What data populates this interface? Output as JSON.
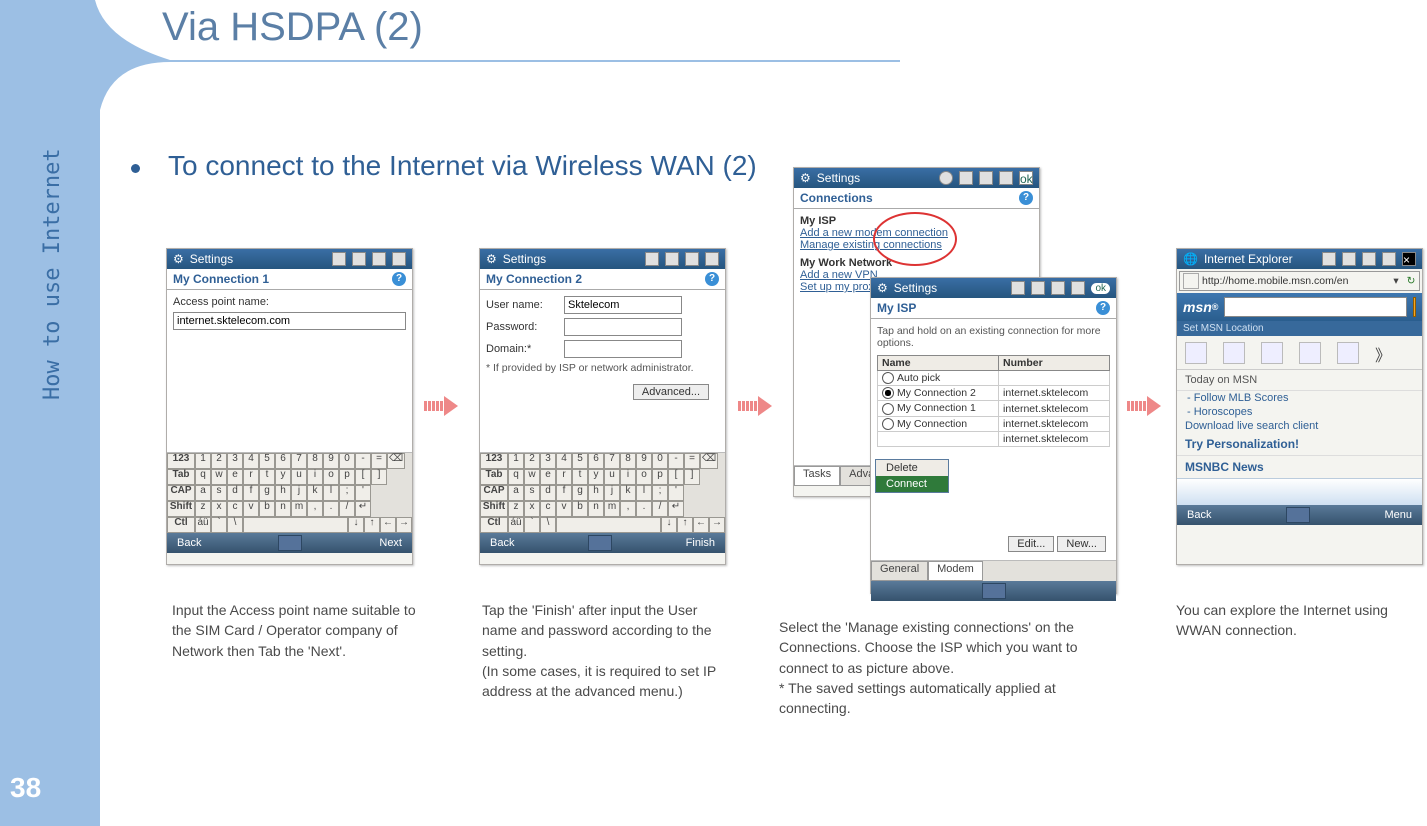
{
  "page_number": "38",
  "side_label": "How to use Internet",
  "title": "Via HSDPA (2)",
  "bullet": "To connect to the Internet via Wireless WAN (2)",
  "steps": {
    "s1": {
      "win_title": "Settings",
      "subbar": "My Connection 1",
      "label_apn": "Access point name:",
      "apn_value": "internet.sktelecom.com",
      "soft_left": "Back",
      "soft_right": "Next",
      "caption": "Input the Access point name suitable to the SIM Card / Operator company of Network then Tab the  'Next'."
    },
    "s2": {
      "win_title": "Settings",
      "subbar": "My Connection 2",
      "label_user": "User name:",
      "user_value": "Sktelecom",
      "label_pass": "Password:",
      "label_domain": "Domain:*",
      "note": "* If provided by ISP or network administrator.",
      "btn_advanced": "Advanced...",
      "soft_left": "Back",
      "soft_right": "Finish",
      "caption": "Tap the 'Finish' after input the User name and password according to the setting.\n(In some cases, it is required to set IP address at the advanced menu.)"
    },
    "s3": {
      "back_win_title": "Settings",
      "back_subbar": "Connections",
      "my_isp": "My ISP",
      "link_add": "Add a new modem connection",
      "link_manage": "Manage existing connections",
      "my_work": "My Work Network",
      "link_add_vpn": "Add a new VPN",
      "link_setup": "Set up my proxy",
      "tasks_tab": "Tasks",
      "advanced_tab": "Advanced",
      "front_win_title": "Settings",
      "front_ok": "ok",
      "front_subbar": "My ISP",
      "front_note": "Tap and hold on an existing connection for more options.",
      "col_name": "Name",
      "col_number": "Number",
      "rows": [
        {
          "name": "Auto pick",
          "number": ""
        },
        {
          "name": "My Connection 2",
          "number": "internet.sktelecom"
        },
        {
          "name": "My Connection 1",
          "number": "internet.sktelecom"
        },
        {
          "name": "My Connection",
          "number": "internet.sktelecom"
        },
        {
          "name": "",
          "number": "internet.sktelecom"
        }
      ],
      "ctx_delete": "Delete",
      "ctx_connect": "Connect",
      "btn_edit": "Edit...",
      "btn_new": "New...",
      "bottom_tab1": "General",
      "bottom_tab2": "Modem",
      "caption": "Select the 'Manage existing connections' on the Connections. Choose the ISP which you want to connect to as picture above.\n * The saved settings automatically applied  at connecting."
    },
    "s4": {
      "win_title": "Internet Explorer",
      "url": "http://home.mobile.msn.com/en",
      "msn": "msn",
      "set_location": "Set MSN Location",
      "section": "Today on MSN",
      "links": [
        "- Follow MLB Scores",
        "- Horoscopes",
        "Download live search client"
      ],
      "bold1": "Try Personalization!",
      "bold2": "MSNBC News",
      "soft_left": "Back",
      "soft_right": "Menu",
      "caption": "You can explore the Internet using WWAN connection."
    }
  },
  "kbd": {
    "r1": [
      "123",
      "1",
      "2",
      "3",
      "4",
      "5",
      "6",
      "7",
      "8",
      "9",
      "0",
      "-",
      "=",
      "⌫"
    ],
    "r2": [
      "Tab",
      "q",
      "w",
      "e",
      "r",
      "t",
      "y",
      "u",
      "i",
      "o",
      "p",
      "[",
      "]"
    ],
    "r3": [
      "CAP",
      "a",
      "s",
      "d",
      "f",
      "g",
      "h",
      "j",
      "k",
      "l",
      ";",
      "'"
    ],
    "r4": [
      "Shift",
      "z",
      "x",
      "c",
      "v",
      "b",
      "n",
      "m",
      ",",
      ".",
      "/",
      "↵"
    ],
    "r5": [
      "Ctl",
      "áü",
      "`",
      "\\",
      " ",
      "↓",
      "↑",
      "←",
      "→"
    ]
  }
}
